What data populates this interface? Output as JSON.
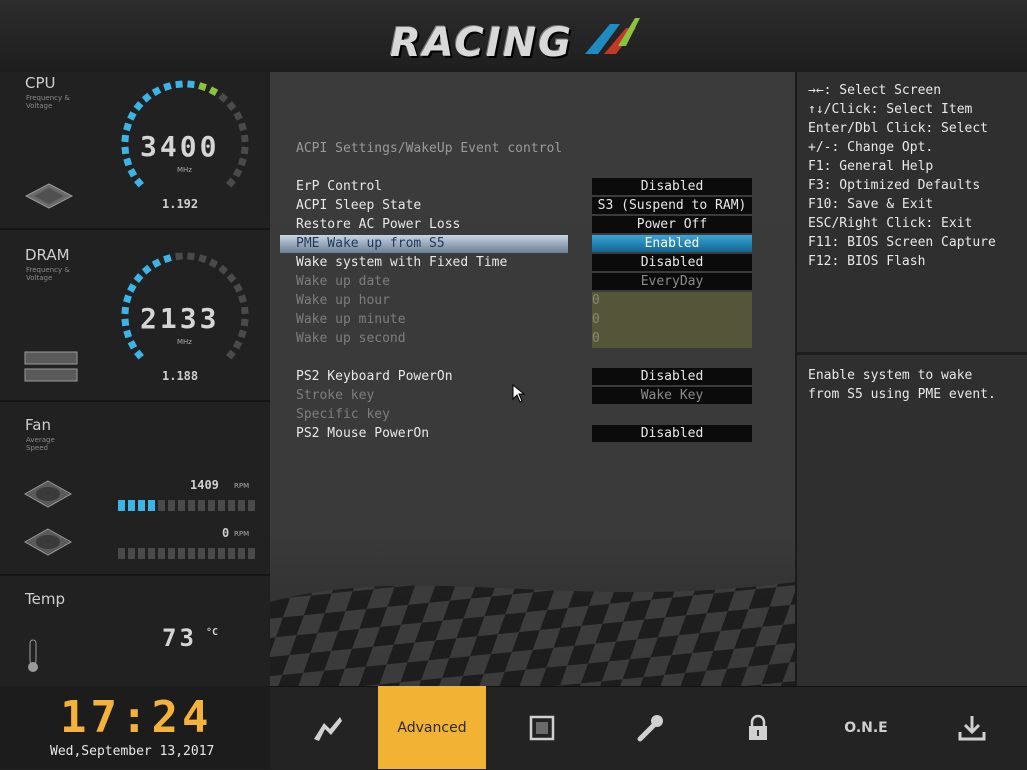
{
  "header": {
    "logo_text": "RACING"
  },
  "sidebar": {
    "cpu": {
      "title": "CPU",
      "subtitle": "Frequency & Voltage",
      "value": "3400",
      "unit": "MHz",
      "voltage": "1.192"
    },
    "dram": {
      "title": "DRAM",
      "subtitle": "Frequency & Voltage",
      "value": "2133",
      "unit": "MHz",
      "voltage": "1.188"
    },
    "fan": {
      "title": "Fan",
      "subtitle": "Average Speed",
      "fan1_rpm": "1409",
      "fan2_rpm": "0",
      "rpm_unit": "RPM",
      "fan1_level": 0.29,
      "fan2_level": 0
    },
    "temp": {
      "title": "Temp",
      "value": "73",
      "unit": "°C"
    }
  },
  "main": {
    "breadcrumb": "ACPI Settings/WakeUp Event control",
    "settings": [
      {
        "label": "ErP Control",
        "value": "Disabled"
      },
      {
        "label": "ACPI Sleep State",
        "value": "S3 (Suspend to RAM)"
      },
      {
        "label": "Restore AC Power Loss",
        "value": "Power Off"
      },
      {
        "label": "PME Wake up from S5",
        "value": "Enabled"
      },
      {
        "label": "Wake system with Fixed Time",
        "value": "Disabled"
      },
      {
        "label": "Wake up date",
        "value": "EveryDay"
      },
      {
        "label": "Wake up hour",
        "value": "0"
      },
      {
        "label": "Wake up minute",
        "value": "0"
      },
      {
        "label": "Wake up second",
        "value": "0"
      },
      {
        "label": "PS2 Keyboard PowerOn",
        "value": "Disabled"
      },
      {
        "label": "Stroke key",
        "value": "Wake Key"
      },
      {
        "label": "Specific key",
        "value": ""
      },
      {
        "label": "PS2 Mouse PowerOn",
        "value": "Disabled"
      }
    ]
  },
  "help": {
    "keys": [
      "→←: Select Screen",
      "↑↓/Click: Select Item",
      "Enter/Dbl Click: Select",
      "+/-: Change Opt.",
      "F1: General Help",
      "F3: Optimized Defaults",
      "F10: Save & Exit",
      "ESC/Right Click: Exit",
      "F11: BIOS Screen Capture",
      "F12: BIOS Flash"
    ],
    "description_line1": "Enable system to wake",
    "description_line2": "from S5 using PME event."
  },
  "footer": {
    "time": "17:24",
    "date": "Wed,September 13,2017",
    "tabs": [
      {
        "icon": "main-icon"
      },
      {
        "label": "Advanced",
        "active": true
      },
      {
        "icon": "chipset-icon"
      },
      {
        "icon": "tool-icon"
      },
      {
        "icon": "security-icon"
      },
      {
        "label": "O.N.E"
      },
      {
        "icon": "save-exit-icon"
      }
    ]
  },
  "colors": {
    "accent": "#f2b233",
    "highlight": "#1e8cc0",
    "gauge_blue": "#3cb4e6",
    "gauge_green": "#8ac43f"
  }
}
